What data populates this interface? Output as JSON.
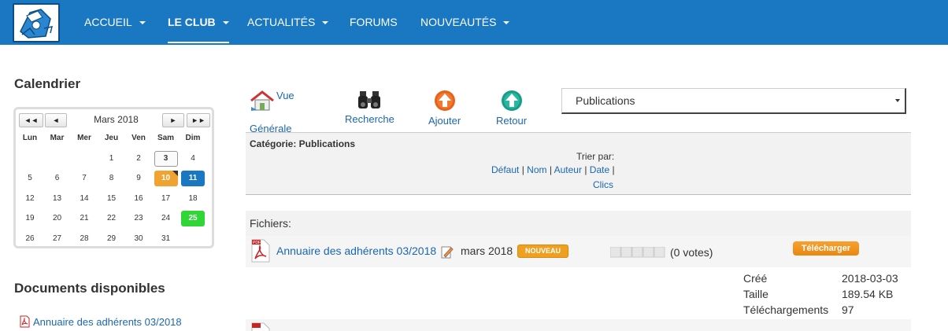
{
  "nav": {
    "items": [
      {
        "label": "ACCUEIL",
        "caret": true
      },
      {
        "label": "LE CLUB",
        "caret": true,
        "active": true
      },
      {
        "label": "ACTUALITÉS",
        "caret": true
      },
      {
        "label": "FORUMS",
        "caret": false
      },
      {
        "label": "NOUVEAUTÉS",
        "caret": true
      }
    ]
  },
  "sidebar": {
    "calendar_title": "Calendrier",
    "calendar": {
      "prev_year": "◄◄",
      "prev_month": "◄",
      "month_label": "Mars 2018",
      "next_month": "►",
      "next_year": "►►",
      "weekdays": [
        "Lun",
        "Mar",
        "Mer",
        "Jeu",
        "Ven",
        "Sam",
        "Dim"
      ],
      "weeks": [
        [
          "",
          "",
          "",
          "1",
          "2",
          "3",
          "4"
        ],
        [
          "5",
          "6",
          "7",
          "8",
          "9",
          "10",
          "11"
        ],
        [
          "12",
          "13",
          "14",
          "15",
          "16",
          "17",
          "18"
        ],
        [
          "19",
          "20",
          "21",
          "22",
          "23",
          "24",
          "25"
        ],
        [
          "26",
          "27",
          "28",
          "29",
          "30",
          "31",
          ""
        ]
      ],
      "today": "3",
      "events": {
        "10": "#f0a330",
        "11": "#1a78c2",
        "25": "#2fd636"
      }
    },
    "documents_title": "Documents disponibles",
    "documents": [
      "Annuaire des adhérents 03/2018"
    ]
  },
  "toolbar": {
    "overview_line1": "Vue",
    "overview_line2": "Générale",
    "search_label": "Recherche",
    "add_label": "Ajouter",
    "back_label": "Retour",
    "category_select": "Publications"
  },
  "category": {
    "title": "Catégorie: Publications",
    "sort_label": "Trier par:",
    "sort_options": [
      "Défaut",
      "Nom",
      "Auteur",
      "Date",
      "Clics"
    ]
  },
  "files": {
    "header": "Fichiers:",
    "items": [
      {
        "name": "Annuaire des adhérents 03/2018",
        "date": "mars 2018",
        "badge": "NOUVEAU",
        "votes": "(0 votes)",
        "download_label": "Télécharger",
        "meta": [
          {
            "label": "Créé",
            "value": "2018-03-03"
          },
          {
            "label": "Taille",
            "value": "189.54 KB"
          },
          {
            "label": "Téléchargements",
            "value": "97"
          }
        ]
      }
    ]
  },
  "colors": {
    "navbar": "#1a78c2",
    "link": "#1a67b0",
    "badge": "#f0a020"
  }
}
